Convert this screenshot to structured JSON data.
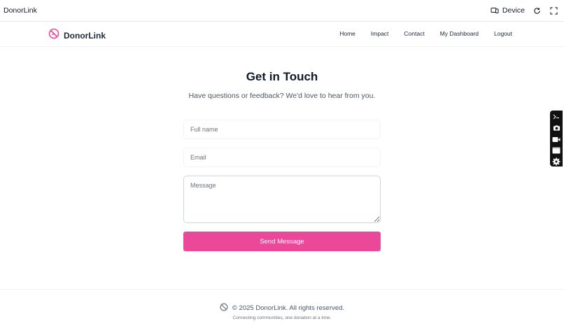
{
  "chrome": {
    "title": "DonorLink",
    "device_label": "Device",
    "icons": [
      "device-icon",
      "refresh-icon",
      "fullscreen-icon"
    ]
  },
  "nav": {
    "brand": "DonorLink",
    "links": [
      "Home",
      "Impact",
      "Contact",
      "My Dashboard",
      "Logout"
    ]
  },
  "main": {
    "heading": "Get in Touch",
    "subheading": "Have questions or feedback? We'd love to hear from you.",
    "fields": {
      "name_placeholder": "Full name",
      "email_placeholder": "Email",
      "message_placeholder": "Message"
    },
    "submit_label": "Send Message"
  },
  "footer": {
    "copyright": "© 2025 DonorLink. All rights reserved.",
    "tagline": "Connecting communities, one donation at a time."
  },
  "sidebar": {
    "icons": [
      "pointer-icon",
      "camera-icon",
      "video-icon",
      "window-icon",
      "gear-icon"
    ]
  },
  "colors": {
    "accent": "#ec4899",
    "text": "#111827",
    "muted": "#4b5563"
  }
}
